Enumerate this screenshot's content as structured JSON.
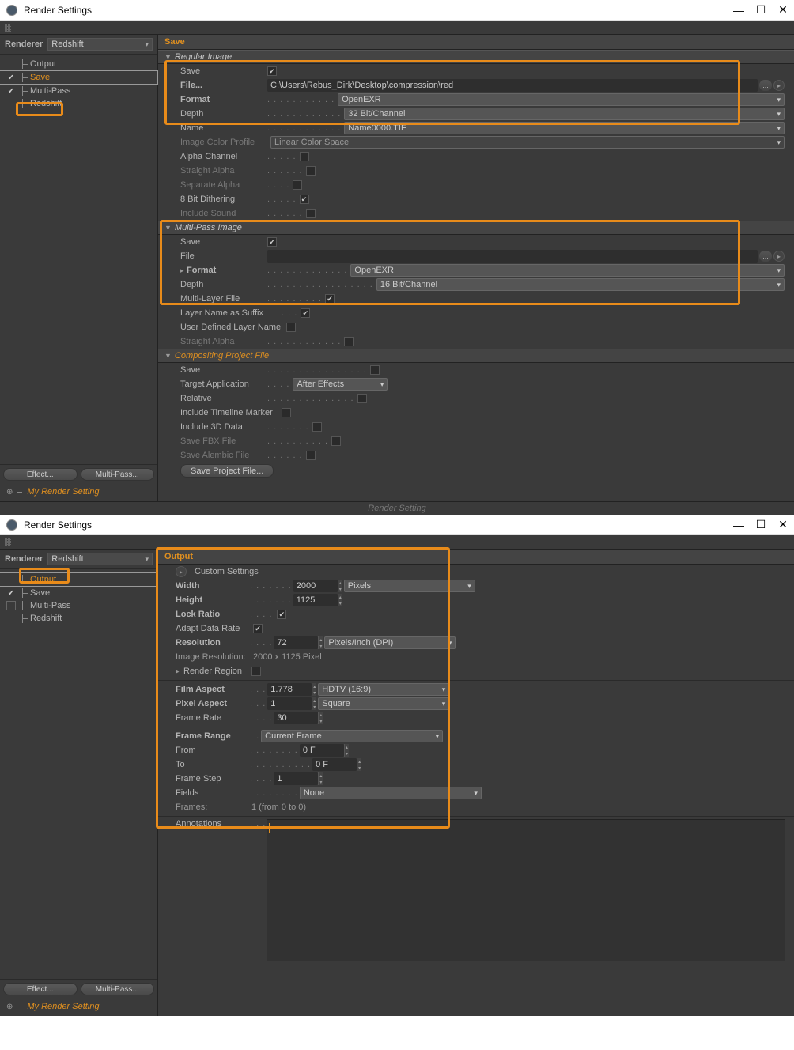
{
  "titlebar": {
    "title": "Render Settings"
  },
  "win1": {
    "renderer_label": "Renderer",
    "renderer_value": "Redshift",
    "nav": {
      "output": "Output",
      "save": "Save",
      "multipass": "Multi-Pass",
      "redshift": "Redshift"
    },
    "btn_effect": "Effect...",
    "btn_multipass": "Multi-Pass...",
    "my_render_setting": "My Render Setting",
    "detail_header": "Save",
    "regular_image": {
      "header": "Regular Image",
      "save_label": "Save",
      "file_label": "File...",
      "file_value": "C:\\Users\\Rebus_Dirk\\Desktop\\compression\\red",
      "format_label": "Format",
      "format_value": "OpenEXR",
      "depth_label": "Depth",
      "depth_value": "32 Bit/Channel",
      "name_label": "Name",
      "name_value": "Name0000.TIF",
      "icp_label": "Image Color Profile",
      "icp_value": "Linear Color Space",
      "alpha_label": "Alpha Channel",
      "straight_label": "Straight Alpha",
      "separate_label": "Separate Alpha",
      "dither_label": "8 Bit Dithering",
      "sound_label": "Include Sound"
    },
    "mp_image": {
      "header": "Multi-Pass Image",
      "save_label": "Save",
      "file_label": "File",
      "file_value": "",
      "format_label": "Format",
      "format_value": "OpenEXR",
      "depth_label": "Depth",
      "depth_value": "16 Bit/Channel",
      "mlf_label": "Multi-Layer File",
      "lns_label": "Layer Name as Suffix",
      "udln_label": "User Defined Layer Name",
      "straight_label": "Straight Alpha"
    },
    "comp": {
      "header": "Compositing Project File",
      "save_label": "Save",
      "target_label": "Target Application",
      "target_value": "After Effects",
      "relative_label": "Relative",
      "tlm_label": "Include Timeline Marker",
      "inc3d_label": "Include 3D Data",
      "fbx_label": "Save FBX File",
      "alembic_label": "Save Alembic File",
      "save_proj_btn": "Save Project File..."
    },
    "render_setting_menu": "Render Setting"
  },
  "win2": {
    "detail_header": "Output",
    "custom_settings": "Custom Settings",
    "width_label": "Width",
    "width_value": "2000",
    "width_unit": "Pixels",
    "height_label": "Height",
    "height_value": "1125",
    "lock_label": "Lock Ratio",
    "adapt_label": "Adapt Data Rate",
    "res_label": "Resolution",
    "res_value": "72",
    "res_unit": "Pixels/Inch (DPI)",
    "imgres_label": "Image Resolution:",
    "imgres_value": "2000 x 1125 Pixel",
    "renderregion_label": "Render Region",
    "film_label": "Film Aspect",
    "film_value": "1.778",
    "film_preset": "HDTV (16:9)",
    "pixel_label": "Pixel Aspect",
    "pixel_value": "1",
    "pixel_preset": "Square",
    "frate_label": "Frame Rate",
    "frate_value": "30",
    "frange_label": "Frame Range",
    "frange_value": "Current Frame",
    "from_label": "From",
    "from_value": "0 F",
    "to_label": "To",
    "to_value": "0 F",
    "fstep_label": "Frame Step",
    "fstep_value": "1",
    "fields_label": "Fields",
    "fields_value": "None",
    "frames_label": "Frames:",
    "frames_value": "1 (from 0 to 0)",
    "annot_label": "Annotations"
  }
}
